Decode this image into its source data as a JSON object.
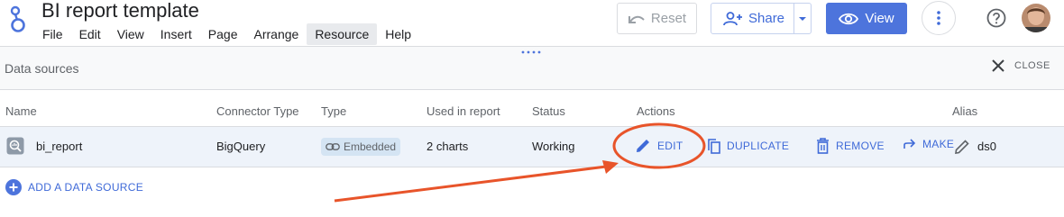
{
  "header": {
    "doc_title": "BI report template",
    "menu": [
      "File",
      "Edit",
      "View",
      "Insert",
      "Page",
      "Arrange",
      "Resource",
      "Help"
    ],
    "active_menu": "Resource",
    "reset_label": "Reset",
    "share_label": "Share",
    "view_label": "View"
  },
  "panel": {
    "title": "Data sources",
    "close_label": "CLOSE",
    "columns": {
      "name": "Name",
      "connector": "Connector Type",
      "type": "Type",
      "used": "Used in report",
      "status": "Status",
      "actions": "Actions",
      "alias": "Alias"
    },
    "rows": [
      {
        "name": "bi_report",
        "connector": "BigQuery",
        "type": "Embedded",
        "used": "2 charts",
        "status": "Working",
        "alias": "ds0"
      }
    ],
    "actions": {
      "edit": "EDIT",
      "duplicate": "DUPLICATE",
      "remove": "REMOVE",
      "make": "MAKE"
    },
    "add_label": "ADD A DATA SOURCE"
  },
  "colors": {
    "accent": "#3f6ad8",
    "view_button": "#4d74dc",
    "annotation": "#e8542a",
    "row_highlight": "#eef3fa"
  }
}
